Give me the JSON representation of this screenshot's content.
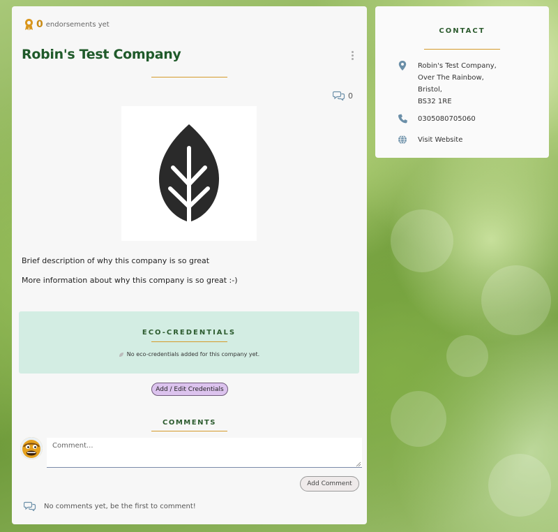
{
  "colors": {
    "title_green": "#1f5a2a",
    "accent_gold": "#d59a2a",
    "eco_panel_bg": "#d3ede3",
    "credentials_button_bg": "#dcc3ee",
    "contact_icon_blue": "#6b8fa8"
  },
  "endorsements": {
    "icon": "award-icon",
    "count": "0",
    "label": "endorsements yet"
  },
  "company": {
    "name": "Robin's Test Company",
    "menu_icon": "kebab-menu-icon",
    "comment_count": "0",
    "logo_icon": "leaf-icon",
    "description_brief": "Brief description of why this company is so great",
    "description_more": "More information about why this company is so great :-)"
  },
  "eco_credentials": {
    "title": "ECO-CREDENTIALS",
    "empty_icon": "leaf-small-icon",
    "empty_text": "No eco-credentials added for this company yet.",
    "button_label": "Add / Edit Credentials"
  },
  "comments": {
    "title": "COMMENTS",
    "input_placeholder": "Comment...",
    "add_button_label": "Add Comment",
    "empty_icon": "speech-bubbles-icon",
    "empty_text": "No comments yet, be the first to comment!"
  },
  "contact": {
    "title": "CONTACT",
    "address_icon": "map-pin-icon",
    "address_lines": [
      "Robin's Test Company,",
      "Over The Rainbow,",
      "Bristol,",
      "BS32 1RE"
    ],
    "phone_icon": "phone-icon",
    "phone": "0305080705060",
    "website_icon": "globe-icon",
    "website_label": "Visit Website"
  }
}
